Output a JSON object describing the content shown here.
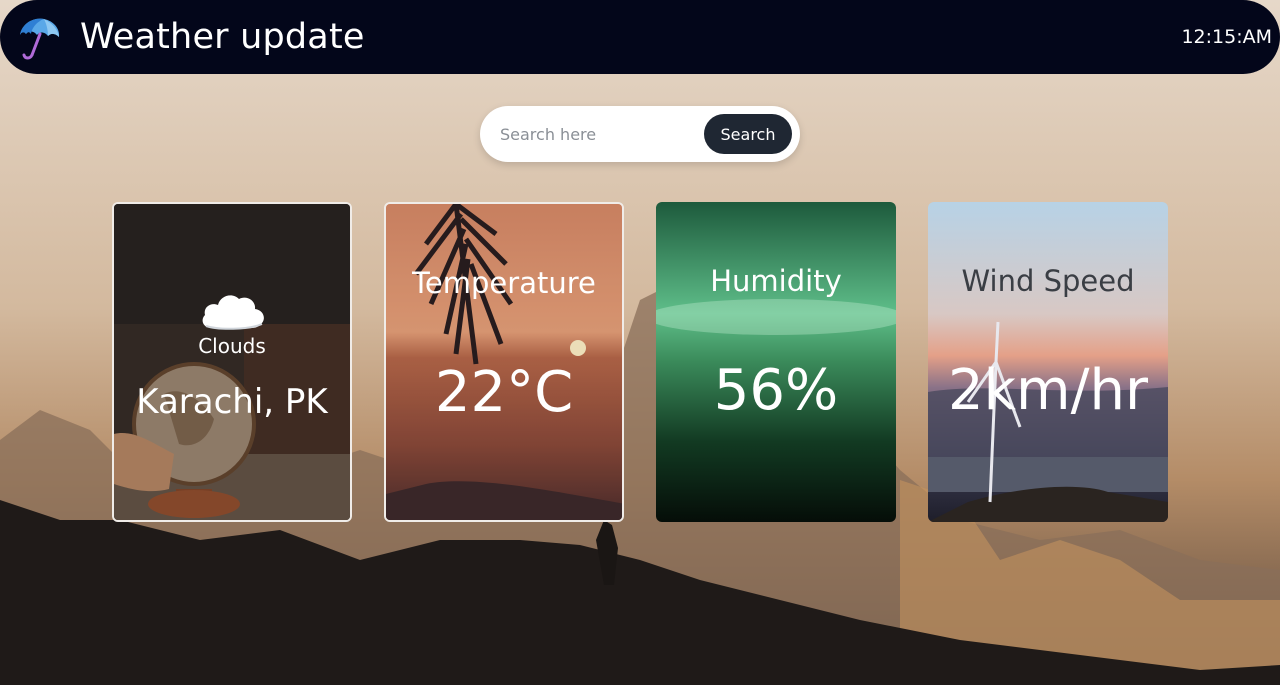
{
  "header": {
    "title": "Weather update",
    "time": "12:15:AM",
    "logo_icon": "umbrella-icon"
  },
  "search": {
    "placeholder": "Search here",
    "button_label": "Search"
  },
  "cards": {
    "location": {
      "condition_icon": "cloud-icon",
      "condition": "Clouds",
      "city": "Karachi, PK"
    },
    "temperature": {
      "title": "Temperature",
      "value": "22°C"
    },
    "humidity": {
      "title": "Humidity",
      "value": "56%"
    },
    "wind": {
      "title": "Wind Speed",
      "value": "2km/hr"
    }
  },
  "colors": {
    "navbar": "#03061a",
    "search_button": "#1f2733",
    "text_light": "#ffffff"
  }
}
